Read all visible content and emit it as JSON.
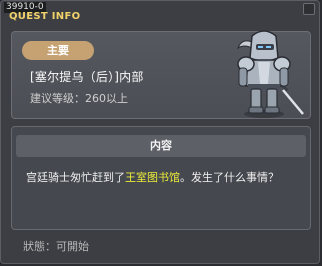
{
  "window": {
    "quest_id": "39910-0",
    "title": "QUEST INFO"
  },
  "header": {
    "badge": "主要",
    "quest_name": "[塞尔提乌（后）]内部",
    "recommended_level": "建议等级：260以上"
  },
  "content": {
    "header": "内容",
    "text_before": "宫廷骑士匆忙赶到了",
    "text_highlight": "王室图书馆",
    "text_after": "。发生了什么事情？"
  },
  "status": "狀態：可開始",
  "colors": {
    "title": "#f1d26a",
    "badge": "#c6a273",
    "highlight": "#ecec39"
  }
}
